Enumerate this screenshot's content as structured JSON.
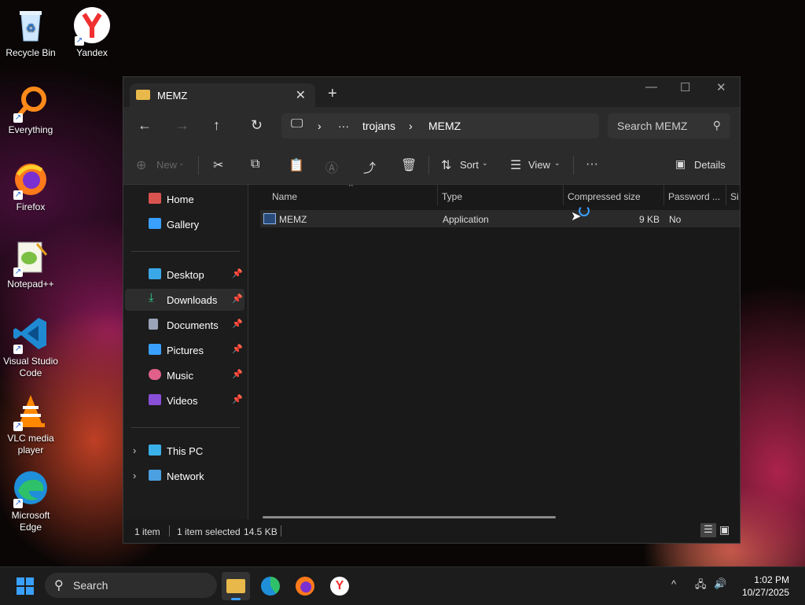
{
  "desktop": {
    "icons": [
      {
        "label": "Recycle Bin"
      },
      {
        "label": "Yandex"
      },
      {
        "label": "Everything"
      },
      {
        "label": "Firefox"
      },
      {
        "label": "Notepad++"
      },
      {
        "label": "Visual Studio Code"
      },
      {
        "label": "VLC media player"
      },
      {
        "label": "Microsoft Edge"
      }
    ]
  },
  "explorer": {
    "tab_title": "MEMZ",
    "breadcrumb": [
      "trojans",
      "MEMZ"
    ],
    "search_placeholder": "Search MEMZ",
    "toolbar": {
      "new_label": "New",
      "sort_label": "Sort",
      "view_label": "View",
      "details_label": "Details"
    },
    "sidebar": {
      "top": [
        {
          "label": "Home",
          "icon": "home-icon"
        },
        {
          "label": "Gallery",
          "icon": "gallery-icon"
        }
      ],
      "quick_access": [
        {
          "label": "Desktop",
          "icon": "desktop-folder-icon"
        },
        {
          "label": "Downloads",
          "icon": "downloads-folder-icon"
        },
        {
          "label": "Documents",
          "icon": "documents-folder-icon"
        },
        {
          "label": "Pictures",
          "icon": "pictures-folder-icon"
        },
        {
          "label": "Music",
          "icon": "music-folder-icon"
        },
        {
          "label": "Videos",
          "icon": "videos-folder-icon"
        }
      ],
      "drives": [
        {
          "label": "This PC",
          "icon": "this-pc-icon"
        },
        {
          "label": "Network",
          "icon": "network-icon"
        }
      ]
    },
    "columns": [
      "Name",
      "Type",
      "Compressed size",
      "Password ...",
      "Si"
    ],
    "files": [
      {
        "name": "MEMZ",
        "type": "Application",
        "compressed_size": "9 KB",
        "password": "No"
      }
    ],
    "status": {
      "count": "1 item",
      "selected": "1 item selected",
      "size": "14.5 KB"
    }
  },
  "taskbar": {
    "search_label": "Search",
    "time": "1:02 PM",
    "date": "10/27/2025"
  },
  "colors": {
    "accent": "#3aa0ff",
    "window_bg": "#191919",
    "folder": "#e8b84a"
  }
}
